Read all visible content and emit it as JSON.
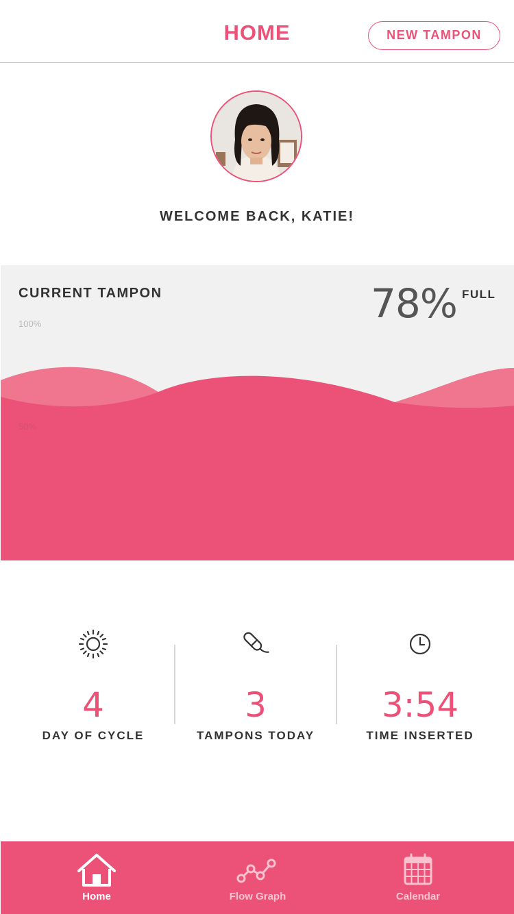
{
  "header": {
    "title": "HOME",
    "new_button_label": "NEW TAMPON"
  },
  "profile": {
    "welcome_text": "WELCOME BACK, KATIE!",
    "avatar_icon": "user-avatar-photo"
  },
  "current_tampon": {
    "title": "CURRENT TAMPON",
    "percent": "78%",
    "percent_suffix": "FULL",
    "fill_fraction": 0.78,
    "tick_top": "100%",
    "tick_mid": "50%"
  },
  "stats": [
    {
      "icon": "sun-icon",
      "value": "4",
      "label": "DAY OF CYCLE"
    },
    {
      "icon": "tampon-icon",
      "value": "3",
      "label": "TAMPONS TODAY"
    },
    {
      "icon": "clock-icon",
      "value": "3:54",
      "label": "TIME INSERTED"
    }
  ],
  "nav": {
    "items": [
      {
        "icon": "home-icon",
        "label": "Home",
        "active": true
      },
      {
        "icon": "flow-graph-icon",
        "label": "Flow Graph",
        "active": false
      },
      {
        "icon": "calendar-icon",
        "label": "Calendar",
        "active": false
      }
    ]
  },
  "colors": {
    "accent": "#ec5278",
    "wave_light": "#f0758f",
    "panel_bg": "#f1f1f1",
    "text_dark": "#333333"
  }
}
